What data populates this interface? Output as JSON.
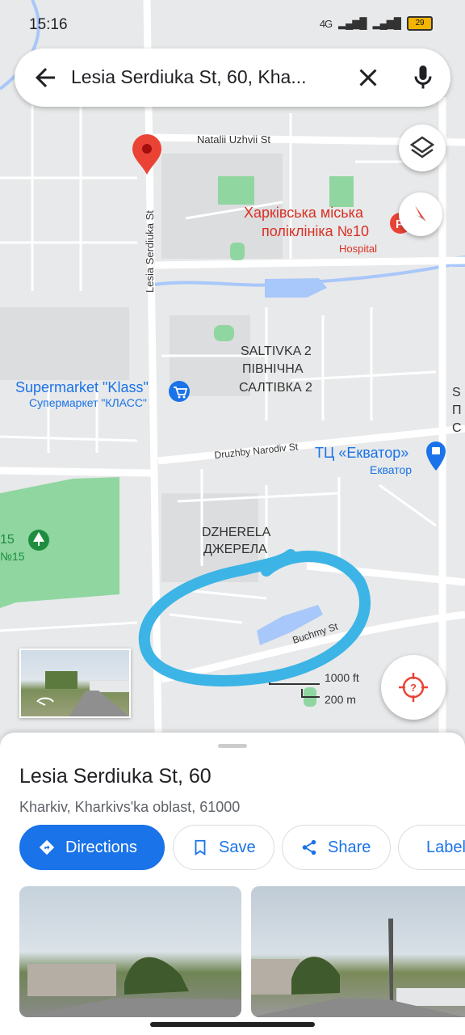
{
  "status_bar": {
    "time": "15:16",
    "network": "4G",
    "battery": "29"
  },
  "search": {
    "query": "Lesia Serdiuka St, 60, Kha..."
  },
  "map": {
    "labels": {
      "natalii": "Natalii Uzhvii St",
      "serdiuka": "Lesia Serdiuka St",
      "polyclinic_1": "Харківська міська",
      "polyclinic_2": "поліклініка №10",
      "hospital": "Hospital",
      "saltivka_en": "SALTIVKA 2",
      "saltivka_ua1": "ПІВНІЧНА",
      "saltivka_ua2": "САЛТІВКА 2",
      "supermarket_en": "Supermarket \"Klass\"",
      "supermarket_ua": "Супермаркет \"КЛАСС\"",
      "druzhby": "Druzhby Narodiv St",
      "ekvator_1": "ТЦ «Екватор»",
      "ekvator_2": "Екватор",
      "dzherela_en": "DZHERELA",
      "dzherela_ua": "ДЖЕРЕЛА",
      "park_num1": "15",
      "park_num2": "№15",
      "buchmy": "Buchmy St",
      "side_1": "S",
      "side_2": "П",
      "side_3": "С"
    },
    "scale": {
      "feet": "1000 ft",
      "meters": "200 m"
    }
  },
  "place": {
    "name": "Lesia Serdiuka St, 60",
    "address": "Kharkiv, Kharkivs'ka oblast, 61000"
  },
  "actions": {
    "directions": "Directions",
    "save": "Save",
    "share": "Share",
    "label": "Label"
  },
  "colors": {
    "accent": "#1a73e8",
    "pin": "#ea4335",
    "annotation": "#3cb4e6",
    "park": "#8fd6a0",
    "water": "#a8c7fa"
  }
}
